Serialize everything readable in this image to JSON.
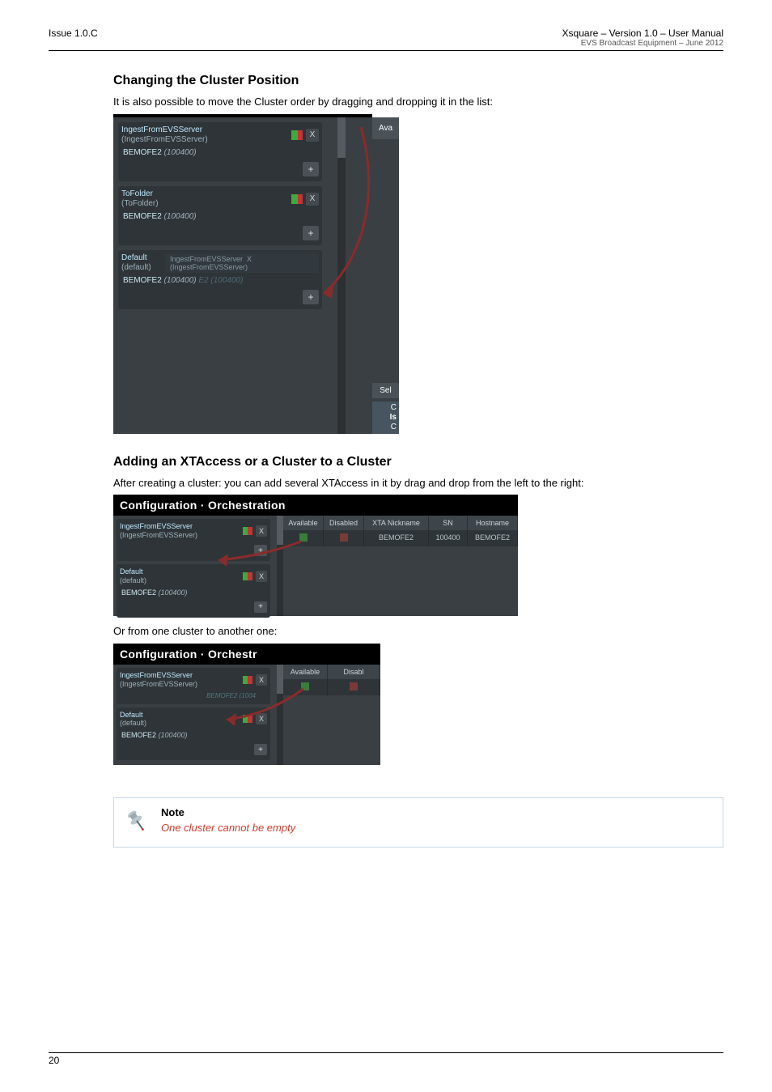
{
  "meta": {
    "left": "Issue 1.0.C",
    "right1": "Xsquare – Version 1.0 – User Manual",
    "right2": "EVS Broadcast Equipment – June 2012",
    "pagenum": "20"
  },
  "sec1": {
    "heading": "Changing the Cluster Position",
    "intro": "It is also possible to move the Cluster order by dragging and dropping it in the list:"
  },
  "shot1": {
    "ava": "Ava",
    "sel": "Sel",
    "c": "C",
    "is": "Is",
    "c2": "C",
    "cards": [
      {
        "title": "IngestFromEVSServer",
        "sub": "(IngestFromEVSServer)",
        "host": "BEMOFE2",
        "hostnum": "(100400)"
      },
      {
        "title": "ToFolder",
        "sub": "(ToFolder)",
        "host": "BEMOFE2",
        "hostnum": "(100400)"
      },
      {
        "title": "Default",
        "sub": "(default)",
        "host": "BEMOFE2",
        "hostnum": "(100400)"
      }
    ],
    "ghost": {
      "title": "IngestFromEVSServer",
      "sub": "(IngestFromEVSServer)",
      "host": "E2 (100400)"
    },
    "x": "X",
    "plus": "+"
  },
  "sec2": {
    "heading": "Adding an XTAccess or a Cluster to a Cluster",
    "intro": "After creating a cluster: you can add several XTAccess in it by drag and drop from the left to the right:"
  },
  "shot2": {
    "bar": "Configuration · Orchestration",
    "cols": {
      "avail": "Available",
      "disabled": "Disabled",
      "nick": "XTA Nickname",
      "sn": "SN",
      "hostname": "Hostname"
    },
    "row": {
      "nick": "BEMOFE2",
      "sn": "100400",
      "hostname": "BEMOFE2"
    },
    "cards": [
      {
        "title": "IngestFromEVSServer",
        "sub": "(IngestFromEVSServer)"
      },
      {
        "title": "Default",
        "sub": "(default)",
        "host": "BEMOFE2",
        "hostnum": "(100400)"
      }
    ]
  },
  "sec3": {
    "text": "Or from one cluster to another one:"
  },
  "shot3": {
    "bar": "Configuration · Orchestr",
    "cols": {
      "avail": "Available",
      "disabled": "Disabl"
    },
    "cards": [
      {
        "title": "IngestFromEVSServer",
        "sub": "(IngestFromEVSServer)",
        "host": "BEMOFE2 (1004"
      },
      {
        "title": "Default",
        "sub": "(default)",
        "host": "BEMOFE2",
        "hostnum": "(100400)"
      }
    ]
  },
  "note": {
    "title": "Note",
    "text": "One cluster cannot be empty"
  }
}
